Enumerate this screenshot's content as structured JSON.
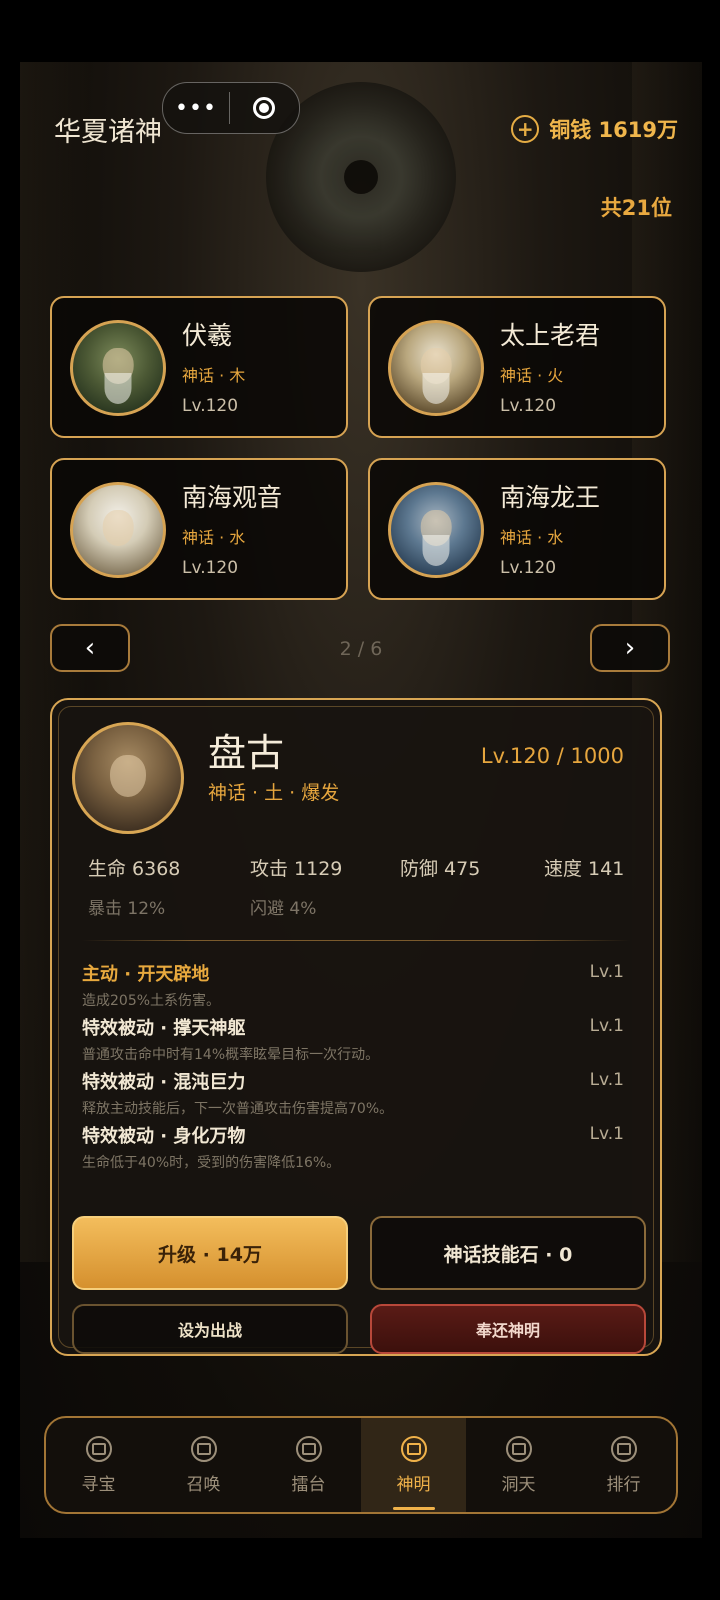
{
  "header": {
    "title": "华夏诸神",
    "capsule_more": "•••",
    "coins_label": "铜钱 1619万",
    "total_count": "共21位"
  },
  "gods": [
    {
      "name": "伏羲",
      "attr": "神话 · 木",
      "level": "Lv.120"
    },
    {
      "name": "太上老君",
      "attr": "神话 · 火",
      "level": "Lv.120"
    },
    {
      "name": "南海观音",
      "attr": "神话 · 水",
      "level": "Lv.120"
    },
    {
      "name": "南海龙王",
      "attr": "神话 · 水",
      "level": "Lv.120"
    }
  ],
  "pager": {
    "prev": "‹",
    "next": "›",
    "text": "2 / 6"
  },
  "detail": {
    "name": "盘古",
    "attr": "神话 · 土 · 爆发",
    "level": "Lv.120 / 1000",
    "stats": {
      "hp": "生命 6368",
      "atk": "攻击 1129",
      "def": "防御 475",
      "spd": "速度 141",
      "crit": "暴击 12%",
      "dodge": "闪避 4%"
    },
    "skills": [
      {
        "title": "主动 · 开天辟地",
        "level": "Lv.1",
        "desc": "造成205%土系伤害。"
      },
      {
        "title": "特效被动 · 撑天神躯",
        "level": "Lv.1",
        "desc": "普通攻击命中时有14%概率眩晕目标一次行动。"
      },
      {
        "title": "特效被动 · 混沌巨力",
        "level": "Lv.1",
        "desc": "释放主动技能后，下一次普通攻击伤害提高70%。"
      },
      {
        "title": "特效被动 · 身化万物",
        "level": "Lv.1",
        "desc": "生命低于40%时，受到的伤害降低16%。"
      }
    ],
    "buttons": {
      "upgrade": "升级 · 14万",
      "skill_stone": "神话技能石 · 0",
      "deploy": "设为出战",
      "return": "奉还神明"
    }
  },
  "tabs": [
    {
      "label": "寻宝",
      "icon": "treasure-icon"
    },
    {
      "label": "召唤",
      "icon": "summon-icon"
    },
    {
      "label": "擂台",
      "icon": "arena-icon"
    },
    {
      "label": "神明",
      "icon": "deity-icon",
      "active": true
    },
    {
      "label": "洞天",
      "icon": "cave-icon"
    },
    {
      "label": "排行",
      "icon": "ranking-icon"
    }
  ],
  "colors": {
    "accent": "#e6a63e",
    "border": "#d6a353",
    "danger": "#b8483a"
  }
}
